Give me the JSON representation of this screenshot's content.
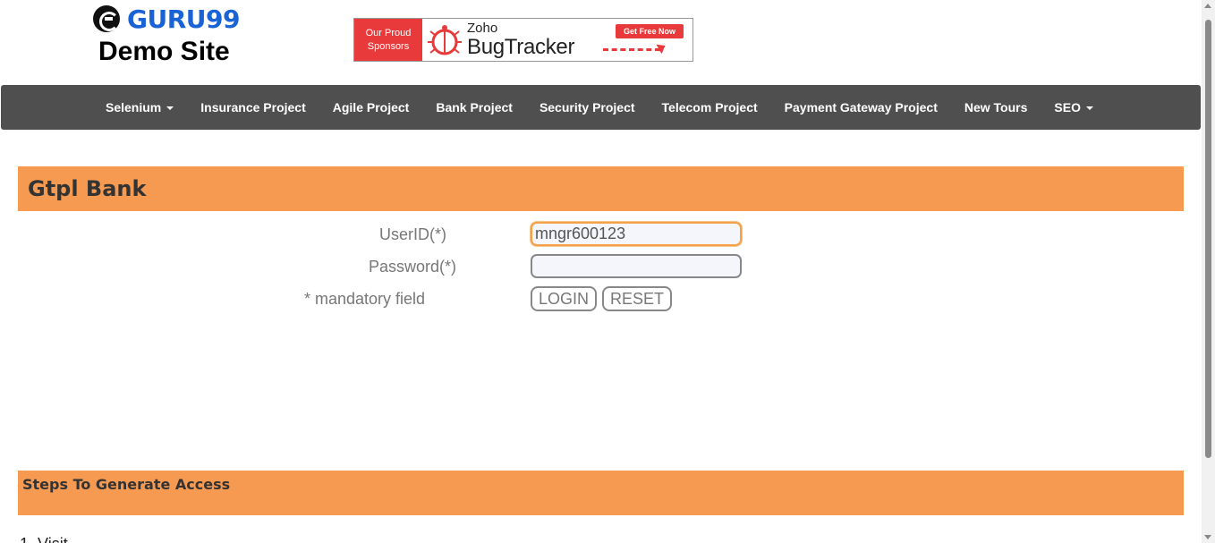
{
  "header": {
    "logo_text": "GURU99",
    "site_title": "Demo Site"
  },
  "banner": {
    "sponsor_line1": "Our Proud",
    "sponsor_line2": "Sponsors",
    "brand_small": "Zoho",
    "brand_name": "BugTracker",
    "cta_label": "Get Free Now"
  },
  "nav": {
    "items": [
      {
        "label": "Selenium",
        "dropdown": true
      },
      {
        "label": "Insurance Project",
        "dropdown": false
      },
      {
        "label": "Agile Project",
        "dropdown": false
      },
      {
        "label": "Bank Project",
        "dropdown": false
      },
      {
        "label": "Security Project",
        "dropdown": false
      },
      {
        "label": "Telecom Project",
        "dropdown": false
      },
      {
        "label": "Payment Gateway Project",
        "dropdown": false
      },
      {
        "label": "New Tours",
        "dropdown": false
      },
      {
        "label": "SEO",
        "dropdown": true
      }
    ]
  },
  "bank": {
    "title": "Gtpl Bank"
  },
  "form": {
    "userid_label": "UserID(*)",
    "userid_value": "mngr600123",
    "password_label": "Password(*)",
    "password_value": "",
    "mandatory_note": "* mandatory field",
    "login_label": "LOGIN",
    "reset_label": "RESET"
  },
  "steps": {
    "title": "Steps To Generate Access",
    "step1": "1. Visit"
  },
  "colors": {
    "accent_orange": "#f79a51",
    "nav_bg": "#4f4f4f",
    "brand_blue": "#1a63d6",
    "sponsor_red": "#e83a3a"
  },
  "icons": {
    "logo": "guru99-logo-icon",
    "bug": "bug-icon",
    "caret": "caret-down-icon"
  }
}
